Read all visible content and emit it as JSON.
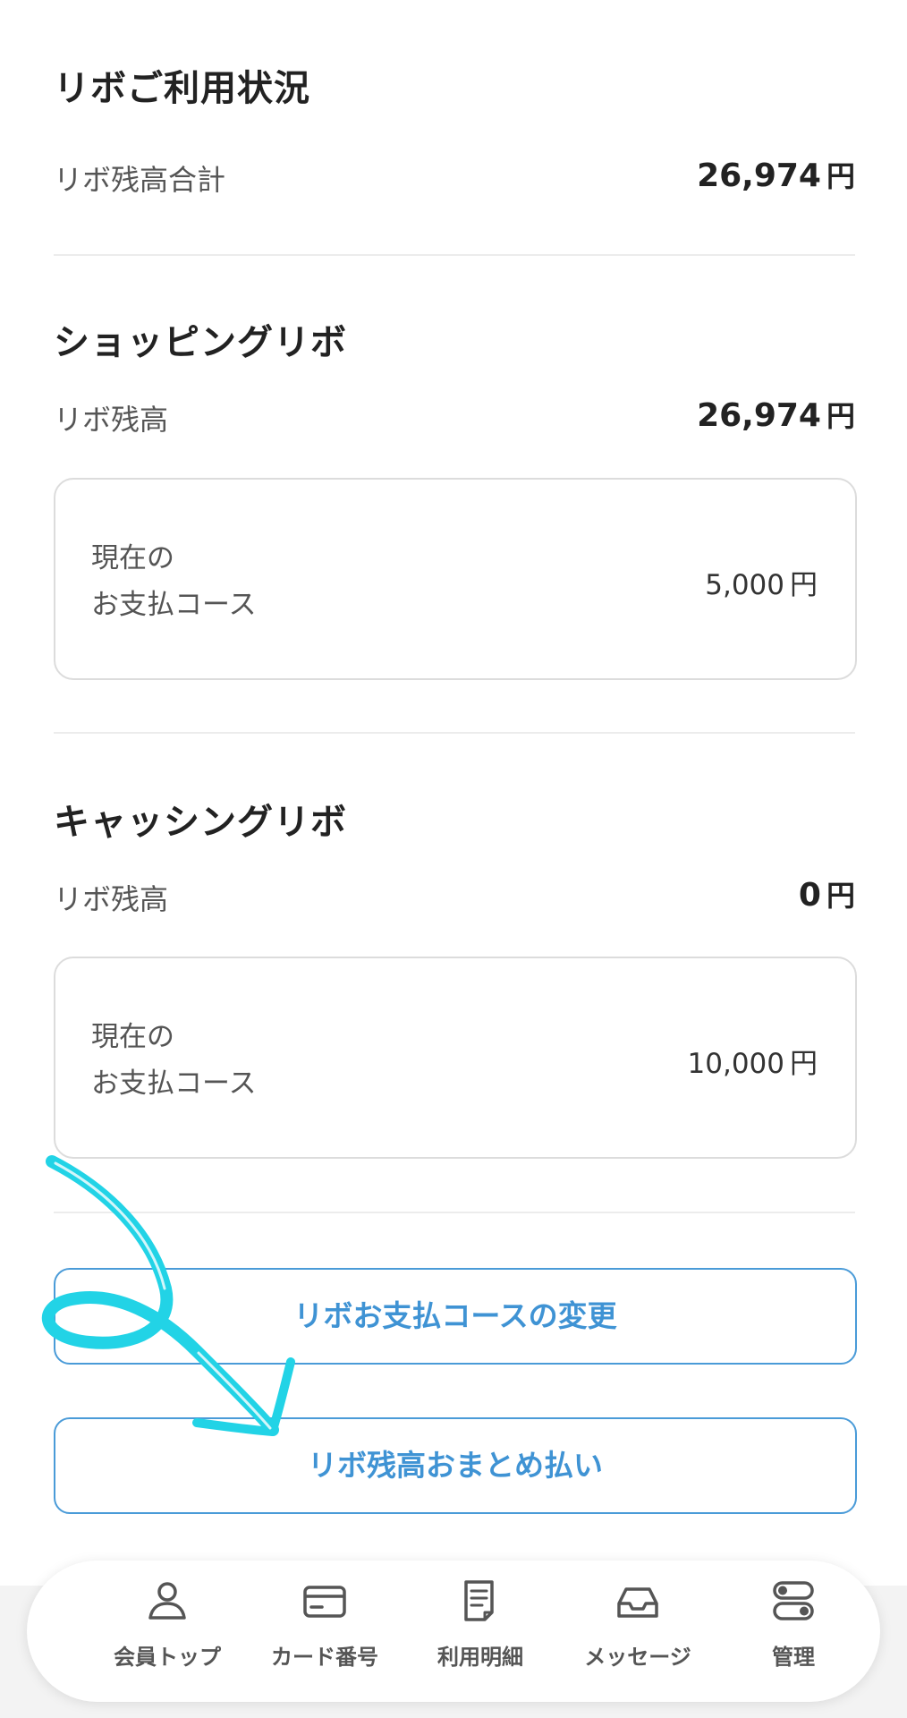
{
  "usage": {
    "title": "リボご利用状況",
    "total_label": "リボ残高合計",
    "total_amount": "26,974",
    "total_unit": "円"
  },
  "shopping": {
    "title": "ショッピングリボ",
    "balance_label": "リボ残高",
    "balance_amount": "26,974",
    "balance_unit": "円",
    "course_label_line1": "現在の",
    "course_label_line2": "お支払コース",
    "course_amount": "5,000",
    "course_unit": "円"
  },
  "cashing": {
    "title": "キャッシングリボ",
    "balance_label": "リボ残高",
    "balance_amount": "0",
    "balance_unit": "円",
    "course_label_line1": "現在の",
    "course_label_line2": "お支払コース",
    "course_amount": "10,000",
    "course_unit": "円"
  },
  "actions": {
    "change_course": "リボお支払コースの変更",
    "lump_sum": "リボ残高おまとめ払い"
  },
  "tabbar": {
    "items": [
      {
        "label": "会員トップ",
        "icon": "person-icon"
      },
      {
        "label": "カード番号",
        "icon": "credit-card-icon"
      },
      {
        "label": "利用明細",
        "icon": "document-icon"
      },
      {
        "label": "メッセージ",
        "icon": "inbox-tray-icon"
      },
      {
        "label": "管理",
        "icon": "toggle-settings-icon"
      }
    ]
  },
  "colors": {
    "accent": "#3f93d4",
    "annotation": "#22d3e6"
  }
}
